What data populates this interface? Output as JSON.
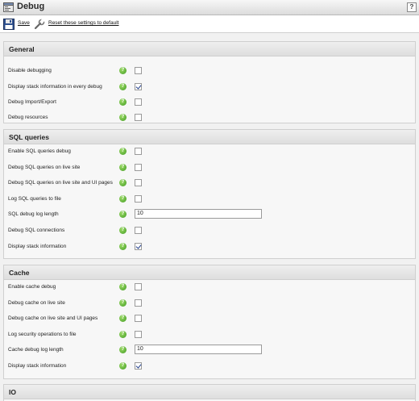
{
  "window": {
    "title": "Debug",
    "help_label": "?"
  },
  "toolbar": {
    "save_label": "Save",
    "reset_label": "Reset these settings to default"
  },
  "sections": [
    {
      "title": "General",
      "rows": [
        {
          "label": "Disable debugging",
          "type": "checkbox",
          "checked": false
        },
        {
          "label": "Display stack information in every debug",
          "type": "checkbox",
          "checked": true
        },
        {
          "label": "Debug Import/Export",
          "type": "checkbox",
          "checked": false
        },
        {
          "label": "Debug resources",
          "type": "checkbox",
          "checked": false
        }
      ]
    },
    {
      "title": "SQL queries",
      "rows": [
        {
          "label": "Enable SQL queries debug",
          "type": "checkbox",
          "checked": false
        },
        {
          "label": "Debug SQL queries on live site",
          "type": "checkbox",
          "checked": false
        },
        {
          "label": "Debug SQL queries on live site and UI pages",
          "type": "checkbox",
          "checked": false
        },
        {
          "label": "Log SQL queries to file",
          "type": "checkbox",
          "checked": false
        },
        {
          "label": "SQL debug log length",
          "type": "text",
          "value": "10"
        },
        {
          "label": "Debug SQL connections",
          "type": "checkbox",
          "checked": false
        },
        {
          "label": "Display stack information",
          "type": "checkbox",
          "checked": true
        }
      ]
    },
    {
      "title": "Cache",
      "rows": [
        {
          "label": "Enable cache debug",
          "type": "checkbox",
          "checked": false
        },
        {
          "label": "Debug cache on live site",
          "type": "checkbox",
          "checked": false
        },
        {
          "label": "Debug cache on live site and UI pages",
          "type": "checkbox",
          "checked": false
        },
        {
          "label": "Log security operations to file",
          "type": "checkbox",
          "checked": false
        },
        {
          "label": "Cache debug log length",
          "type": "text",
          "value": "10"
        },
        {
          "label": "Display stack information",
          "type": "checkbox",
          "checked": true
        }
      ]
    },
    {
      "title": "IO",
      "rows": []
    }
  ],
  "icons": {
    "window": "debug-window-icon",
    "save": "floppy-disk-icon",
    "reset": "wrench-icon",
    "help": "question-help-icon"
  },
  "colors": {
    "help_icon": "#4caf2a",
    "checkmark": "#1f3c8a"
  }
}
